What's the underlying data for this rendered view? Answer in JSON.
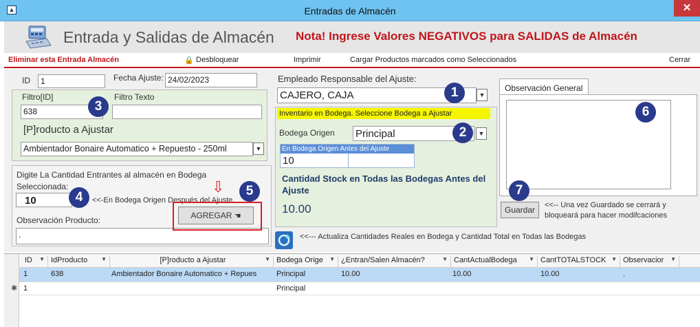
{
  "window": {
    "title": "Entradas de Almacén",
    "close_glyph": "✕"
  },
  "header": {
    "title": "Entrada y Salidas de Almacén",
    "note": "Nota! Ingrese Valores NEGATIVOS para SALIDAS de Almacén"
  },
  "commands": {
    "delete": "Eliminar esta Entrada Almacén",
    "unlock": "Desbloquear",
    "print": "Imprimir",
    "load_selected": "Cargar Productos marcados como Seleccionados",
    "close": "Cerrar"
  },
  "form": {
    "id_label": "ID",
    "id_value": "1",
    "date_label": "Fecha Ajuste:",
    "date_value": "24/02/2023",
    "filter_id_label": "Filtro[ID]",
    "filter_id_value": "638",
    "filter_text_label": "Filtro Texto",
    "filter_text_value": "",
    "product_label": "[P]roducto a Ajustar",
    "product_value": "Ambientador Bonaire Automatico + Repuesto - 250ml",
    "qty_label_1": "Digite La Cantidad Entrantes al almacén en Bodega",
    "qty_label_2": "Seleccionada:",
    "qty_value": "10",
    "qty_hint": "<<-En Bodega Origen Después del Ajuste",
    "obs_product_label": "Observación Producto:",
    "obs_product_value": ".",
    "add_button": "AGREGAR",
    "employee_label": "Empleado Responsable del Ajuste:",
    "employee_value": "CAJERO, CAJA",
    "warehouse_banner": "Inventario en Bodega. Seleccione Bodega a Ajustar",
    "warehouse_label": "Bodega Origen",
    "warehouse_value": "Principal",
    "stock_before_header": "En Bodega Origen Antes del Ajuste",
    "stock_before_value": "10",
    "total_stock_label": "Cantidad Stock en Todas las Bodegas Antes del Ajuste",
    "total_stock_value": "10.00",
    "refresh_hint": "<<--- Actualiza Cantidades Reales en Bodega y Cantidad Total en Todas las Bodegas",
    "obs_general_tab": "Observación General",
    "obs_general_value": "",
    "save_button": "Guardar",
    "save_hint_1": "<<-- Una vez Guardado se cerrará y",
    "save_hint_2": "bloqueará para hacer modifcaciones"
  },
  "badges": [
    "1",
    "2",
    "3",
    "4",
    "5",
    "6",
    "7"
  ],
  "grid": {
    "columns": [
      "ID",
      "IdProducto",
      "[P]roducto a Ajustar",
      "Bodega Orige",
      "¿Entran/Salen Almacén?",
      "CantActualBodega",
      "CantTOTALSTOCK",
      "Observacior"
    ],
    "rows": [
      [
        "1",
        "638",
        "Ambientador Bonaire Automatico + Repues",
        "Principal",
        "10.00",
        "10.00",
        "10.00",
        "."
      ],
      [
        "1",
        "",
        "",
        "Principal",
        "",
        "",
        "",
        ""
      ]
    ],
    "new_row_marker": "✱"
  },
  "colors": {
    "accent_red": "#c0161c",
    "titlebar": "#6ec3f0",
    "banner_yellow": "#f5f500",
    "badge": "#2a3a8c",
    "selected_row": "#bcd9f5"
  }
}
